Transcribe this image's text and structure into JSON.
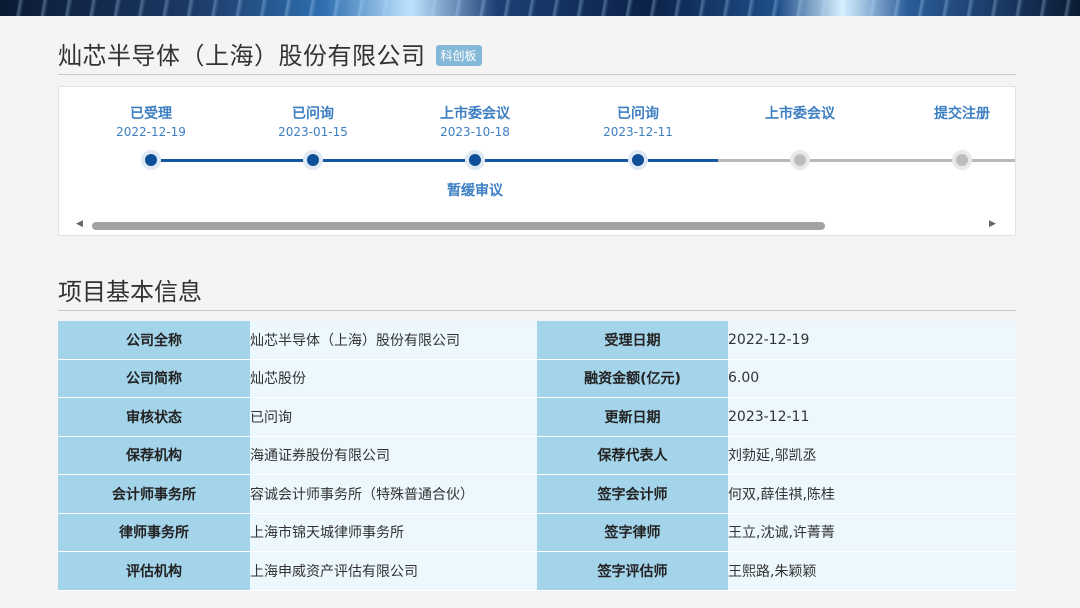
{
  "header": {
    "company_name": "灿芯半导体（上海）股份有限公司",
    "board_badge": "科创板"
  },
  "timeline": {
    "steps": [
      {
        "label": "已受理",
        "date": "2022-12-19",
        "status": "done"
      },
      {
        "label": "已问询",
        "date": "2023-01-15",
        "status": "done"
      },
      {
        "label": "上市委会议",
        "date": "2023-10-18",
        "status": "done",
        "sub_label": "暂缓审议"
      },
      {
        "label": "已问询",
        "date": "2023-12-11",
        "status": "done"
      },
      {
        "label": "上市委会议",
        "date": "",
        "status": "pending"
      },
      {
        "label": "提交注册",
        "date": "",
        "status": "pending"
      }
    ],
    "scroll_left": "◀",
    "scroll_right": "▶"
  },
  "section": {
    "title": "项目基本信息"
  },
  "info_rows": [
    {
      "k1": "公司全称",
      "v1": "灿芯半导体（上海）股份有限公司",
      "k2": "受理日期",
      "v2": "2022-12-19"
    },
    {
      "k1": "公司简称",
      "v1": "灿芯股份",
      "k2": "融资金额(亿元)",
      "v2": "6.00"
    },
    {
      "k1": "审核状态",
      "v1": "已问询",
      "k2": "更新日期",
      "v2": "2023-12-11"
    },
    {
      "k1": "保荐机构",
      "v1": "海通证券股份有限公司",
      "k2": "保荐代表人",
      "v2": "刘勃延,邬凯丞"
    },
    {
      "k1": "会计师事务所",
      "v1": "容诚会计师事务所（特殊普通合伙）",
      "k2": "签字会计师",
      "v2": "何双,薛佳祺,陈桂"
    },
    {
      "k1": "律师事务所",
      "v1": "上海市锦天城律师事务所",
      "k2": "签字律师",
      "v2": "王立,沈诚,许菁菁"
    },
    {
      "k1": "评估机构",
      "v1": "上海申威资产评估有限公司",
      "k2": "签字评估师",
      "v2": "王熙路,朱颖颖"
    }
  ],
  "colors": {
    "accent_blue": "#3d7fc2",
    "track_blue": "#1557a3",
    "key_cell": "#a4d4ea",
    "value_cell": "#ecf8fd",
    "badge": "#84b8d8"
  }
}
